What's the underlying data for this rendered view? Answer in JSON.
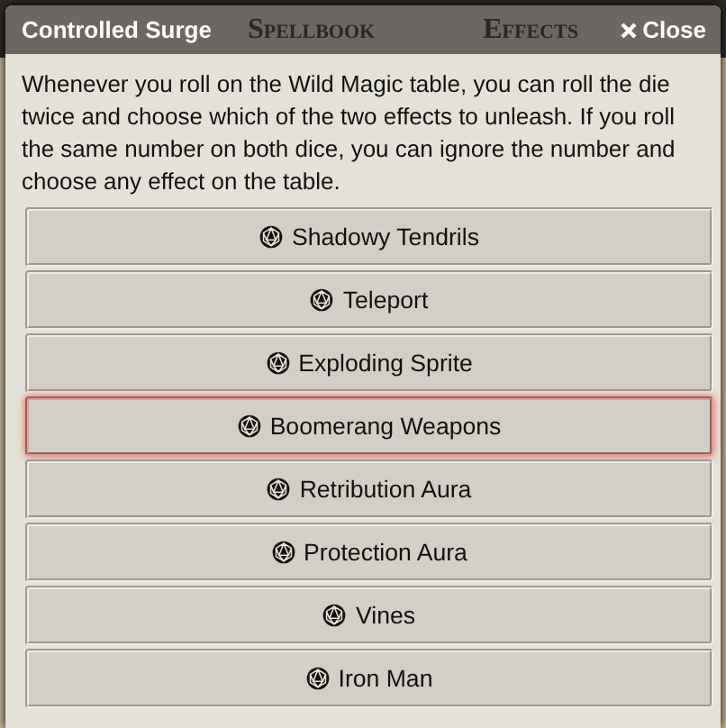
{
  "background_tabs": [
    {
      "label": "Spellbook"
    },
    {
      "label": "Effects"
    }
  ],
  "dialog": {
    "title": "Controlled Surge",
    "close": "Close",
    "description": "Whenever you roll on the Wild Magic table, you can roll the die twice and choose which of the two effects to unleash. If you roll the same number on both dice, you can ignore the number and choose any effect on the table.",
    "options": [
      {
        "label": "Shadowy Tendrils",
        "selected": false
      },
      {
        "label": "Teleport",
        "selected": false
      },
      {
        "label": "Exploding Sprite",
        "selected": false
      },
      {
        "label": "Boomerang Weapons",
        "selected": true
      },
      {
        "label": "Retribution Aura",
        "selected": false
      },
      {
        "label": "Protection Aura",
        "selected": false
      },
      {
        "label": "Vines",
        "selected": false
      },
      {
        "label": "Iron Man",
        "selected": false
      }
    ]
  }
}
